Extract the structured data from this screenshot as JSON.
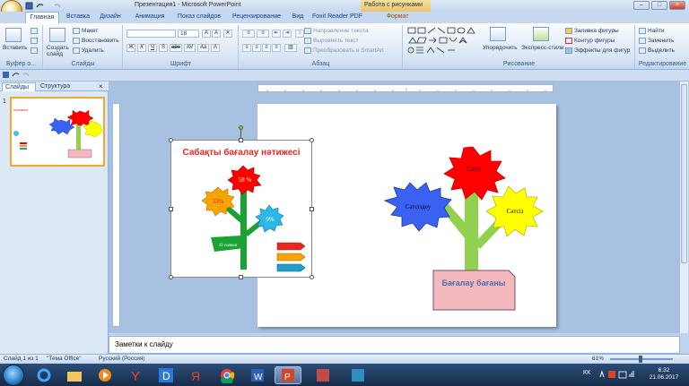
{
  "window": {
    "title": "Презентация1 - Microsoft PowerPoint",
    "context_title": "Работа с рисунками"
  },
  "tabs": [
    {
      "label": "Главная",
      "active": true
    },
    {
      "label": "Вставка"
    },
    {
      "label": "Дизайн"
    },
    {
      "label": "Анимация"
    },
    {
      "label": "Показ слайдов"
    },
    {
      "label": "Рецензирование"
    },
    {
      "label": "Вид"
    },
    {
      "label": "Foxit Reader PDF"
    },
    {
      "label": "Формат",
      "context": true
    }
  ],
  "ribbon": {
    "clipboard": {
      "paste": "Вставить",
      "label": "Буфер о..."
    },
    "slides": {
      "create": "Создать слайд",
      "layout": "Макет",
      "reset": "Восстановить",
      "delete": "Удалить",
      "label": "Слайды"
    },
    "font": {
      "size": "18",
      "label": "Шрифт",
      "buttons": [
        "Ж",
        "К",
        "Ч",
        "S",
        "abe",
        "AV",
        "Aa",
        "A"
      ]
    },
    "paragraph": {
      "direction": "Направление текста",
      "align": "Выровнять текст",
      "smartart": "Преобразовать в SmartArt",
      "label": "Абзац"
    },
    "drawing": {
      "arrange": "Упорядочить",
      "quickstyles": "Экспресс-стили",
      "fill": "Заливка фигуры",
      "outline": "Контур фигуры",
      "effects": "Эффекты для фигур",
      "label": "Рисование"
    },
    "editing": {
      "find": "Найти",
      "replace": "Заменить",
      "select": "Выделить",
      "label": "Редактирование"
    }
  },
  "leftpane": {
    "tabs": [
      "Слайды",
      "Структура"
    ],
    "slide_number": "1"
  },
  "picture": {
    "title": "Сабақты бағалау нәтижесі",
    "petal_top": "58 %",
    "petal_left": "33%",
    "petal_right": "9%",
    "leaf": "10 сынып"
  },
  "slide": {
    "flower_top": "Сәтті",
    "flower_left": "Сәтсіздеу",
    "flower_right": "Сәтсіз",
    "pot": "Бағалау бағаны"
  },
  "notes": {
    "placeholder": "Заметки к слайду"
  },
  "status": {
    "slide": "Слайд 1 из 1",
    "theme": "\"Тема Office\"",
    "language": "Русский (Россия)",
    "zoom": "61%"
  },
  "taskbar": {
    "lang": "КК",
    "time": "6:32",
    "date": "21.06.2017"
  },
  "colors": {
    "burst_red": "#ff0000",
    "burst_blue": "#3a62f2",
    "burst_yellow": "#ffff00",
    "stem_green": "#92d050",
    "pot_pink": "#f4b9bd",
    "title_red": "#e8271f"
  }
}
